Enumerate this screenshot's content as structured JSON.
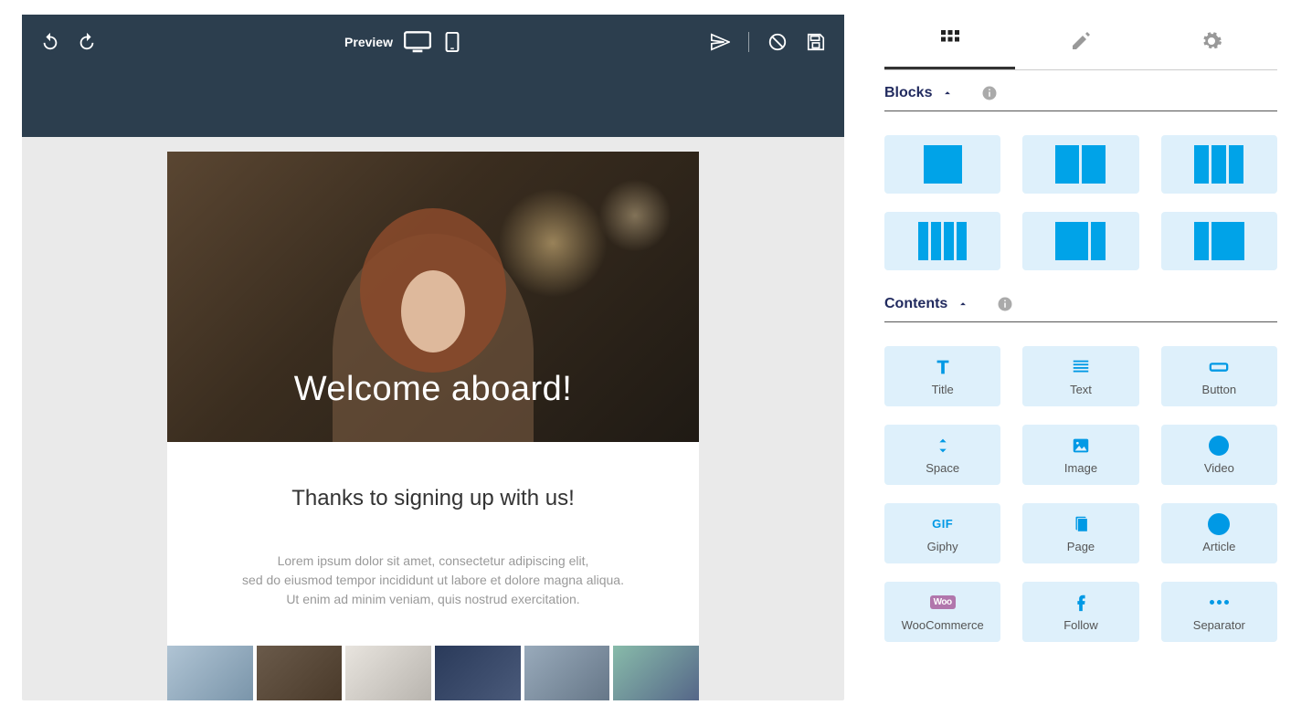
{
  "toolbar": {
    "preview_label": "Preview"
  },
  "email": {
    "hero_title": "Welcome aboard!",
    "subheadline": "Thanks to signing up with us!",
    "paragraph": "Lorem ipsum dolor sit amet, consectetur adipiscing elit,\nsed do eiusmod tempor incididunt ut labore et dolore magna aliqua.\nUt enim ad minim veniam, quis nostrud exercitation."
  },
  "sidebar": {
    "sections": {
      "blocks": "Blocks",
      "contents": "Contents"
    },
    "contents": [
      {
        "id": "title",
        "label": "Title"
      },
      {
        "id": "text",
        "label": "Text"
      },
      {
        "id": "button",
        "label": "Button"
      },
      {
        "id": "space",
        "label": "Space"
      },
      {
        "id": "image",
        "label": "Image"
      },
      {
        "id": "video",
        "label": "Video"
      },
      {
        "id": "giphy",
        "label": "Giphy"
      },
      {
        "id": "page",
        "label": "Page"
      },
      {
        "id": "article",
        "label": "Article"
      },
      {
        "id": "woocommerce",
        "label": "WooCommerce"
      },
      {
        "id": "follow",
        "label": "Follow"
      },
      {
        "id": "separator",
        "label": "Separator"
      }
    ],
    "giphy_badge": "GIF",
    "woo_badge": "Woo"
  }
}
